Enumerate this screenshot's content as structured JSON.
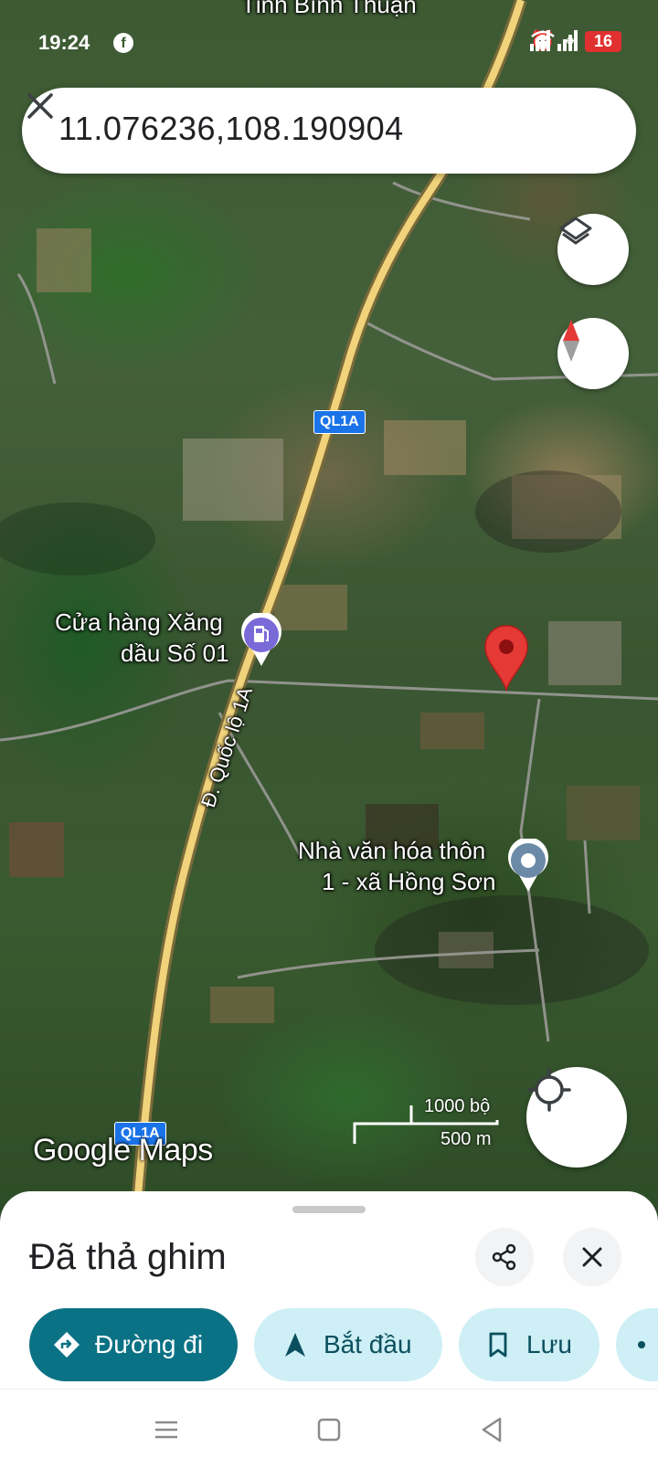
{
  "status_bar": {
    "time": "19:24",
    "battery": "16",
    "app_icon": "facebook-icon"
  },
  "search": {
    "query": "11.076236,108.190904",
    "clear_icon": "close-icon"
  },
  "map": {
    "top_label": "Tỉnh Bình Thuận",
    "road_shields": [
      "QL1A",
      "QL1A"
    ],
    "road_name": "Đ. Quốc lộ 1A",
    "places": [
      {
        "line1": "Cửa hàng Xăng",
        "line2": "dầu Số 01",
        "icon": "gas-station-icon"
      },
      {
        "line1": "Nhà văn hóa thôn",
        "line2": "1 - xã Hồng Sơn",
        "icon": "place-icon"
      }
    ],
    "watermark": "Google Maps",
    "scale": {
      "imperial": "1000 bộ",
      "metric": "500 m"
    },
    "pin_color": "#e53935"
  },
  "sheet": {
    "title": "Đã thả ghim",
    "actions": {
      "directions": "Đường đi",
      "start": "Bắt đầu",
      "save": "Lưu"
    }
  },
  "colors": {
    "primary": "#0b7285",
    "secondary_chip": "#cdeff5"
  }
}
